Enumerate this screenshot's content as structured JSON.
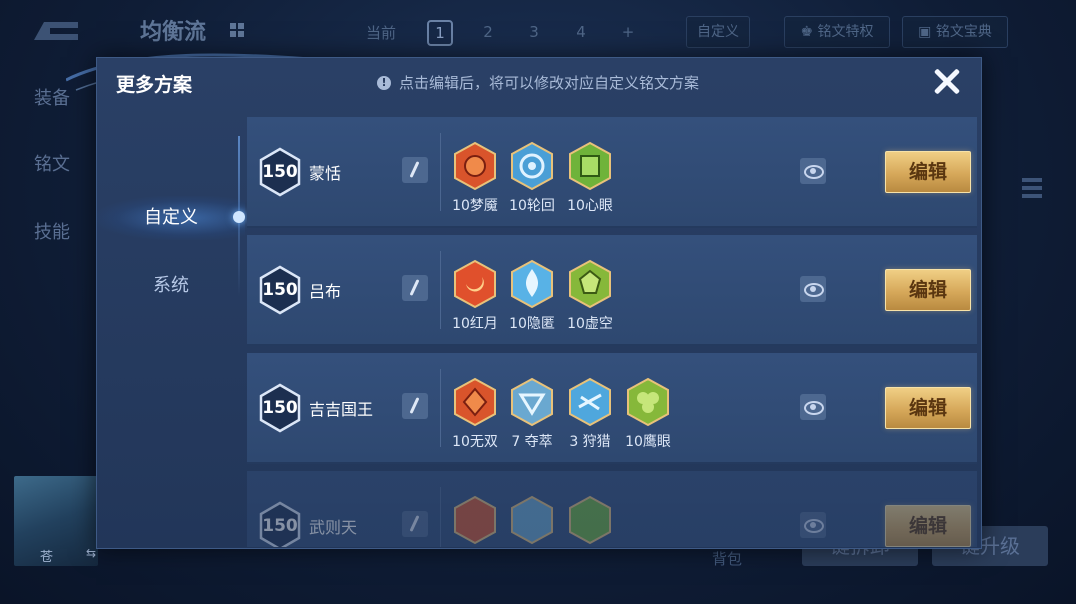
{
  "background": {
    "title": "均衡流",
    "current_label": "当前",
    "pages": [
      "1",
      "2",
      "3",
      "4",
      "+"
    ],
    "active_page": "1",
    "custom_button": "自定义",
    "privilege_button": "铭文特权",
    "guide_button": "铭文宝典",
    "side_items": [
      "装备",
      "铭文",
      "技能"
    ],
    "hero_name": "苍",
    "hero_swap": "⇆",
    "bottom_text": "背包",
    "bottom_buttons": [
      "键拆卸",
      "键升级"
    ]
  },
  "modal": {
    "title": "更多方案",
    "notice": "点击编辑后，将可以修改对应自定义铭文方案",
    "notice_icon": "!",
    "tabs": [
      {
        "label": "自定义",
        "active": true
      },
      {
        "label": "系统",
        "active": false
      }
    ],
    "edit_label": "编辑",
    "schemes": [
      {
        "level": "150",
        "name": "蒙恬",
        "runes": [
          {
            "label": "10梦魇",
            "color": "#d9542b"
          },
          {
            "label": "10轮回",
            "color": "#4a9fd6"
          },
          {
            "label": "10心眼",
            "color": "#6fb33a"
          }
        ]
      },
      {
        "level": "150",
        "name": "吕布",
        "runes": [
          {
            "label": "10红月",
            "color": "#e0502c"
          },
          {
            "label": "10隐匿",
            "color": "#58b2e6"
          },
          {
            "label": "10虚空",
            "color": "#86b83a"
          }
        ]
      },
      {
        "level": "150",
        "name": "吉吉国王",
        "runes": [
          {
            "label": "10无双",
            "color": "#d9542b"
          },
          {
            "label": "7 夺萃",
            "color": "#6aa8d0"
          },
          {
            "label": "3 狩猎",
            "color": "#4fa7dd"
          },
          {
            "label": "10鹰眼",
            "color": "#86b83a"
          }
        ]
      },
      {
        "level": "150",
        "name": "武则天",
        "runes": [
          {
            "label": "",
            "color": "#d9542b"
          },
          {
            "label": "",
            "color": "#6aa8d0"
          },
          {
            "label": "",
            "color": "#6fb33a"
          }
        ]
      }
    ]
  }
}
